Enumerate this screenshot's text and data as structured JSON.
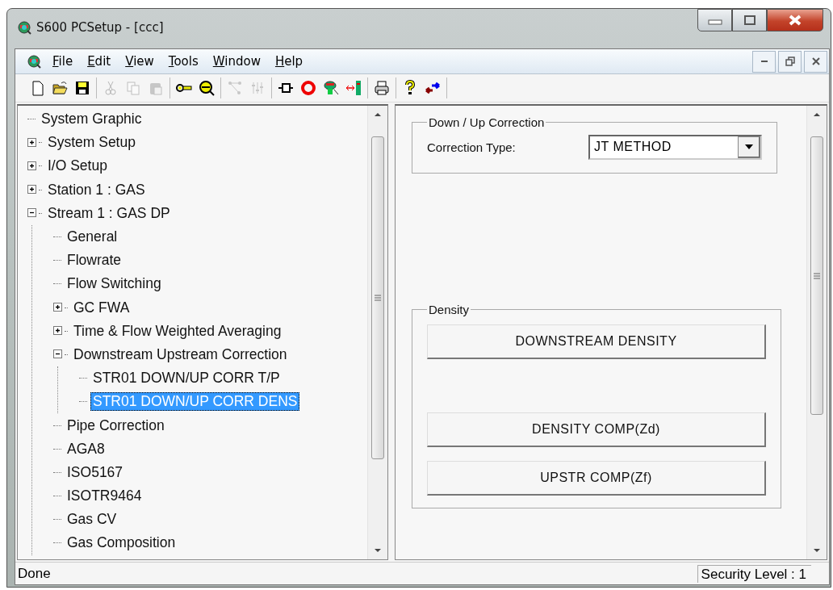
{
  "window": {
    "title": "S600 PCSetup - [ccc]"
  },
  "menu": [
    "File",
    "Edit",
    "View",
    "Tools",
    "Window",
    "Help"
  ],
  "toolbar": [
    [
      {
        "disabled": false
      },
      {
        "disabled": false
      },
      {
        "disabled": false
      }
    ],
    [
      {
        "disabled": true
      },
      {
        "disabled": true
      },
      {
        "disabled": true
      }
    ],
    [
      {
        "disabled": false
      },
      {
        "disabled": false
      }
    ],
    [
      {
        "disabled": true
      },
      {
        "disabled": true
      }
    ],
    [
      {
        "disabled": false
      },
      {
        "disabled": false
      },
      {
        "disabled": false
      },
      {
        "disabled": false
      }
    ],
    [
      {
        "disabled": false
      }
    ],
    [
      {
        "disabled": false
      },
      {
        "disabled": false
      }
    ]
  ],
  "tree": [
    {
      "label": "System Graphic",
      "selected": false
    },
    {
      "label": "System Setup",
      "expanded": false,
      "selected": false
    },
    {
      "label": "I/O Setup",
      "expanded": false,
      "selected": false
    },
    {
      "label": "Station 1 : GAS",
      "expanded": false,
      "selected": false
    },
    {
      "label": "Stream 1 : GAS DP",
      "expanded": true,
      "selected": false,
      "children": [
        {
          "label": "General",
          "selected": false
        },
        {
          "label": "Flowrate",
          "selected": false
        },
        {
          "label": "Flow Switching",
          "selected": false
        },
        {
          "label": "GC FWA",
          "expanded": false,
          "selected": false
        },
        {
          "label": "Time & Flow Weighted Averaging",
          "expanded": false,
          "selected": false
        },
        {
          "label": "Downstream Upstream Correction",
          "expanded": true,
          "selected": false,
          "children": [
            {
              "label": "STR01 DOWN/UP CORR T/P",
              "selected": false
            },
            {
              "label": "STR01 DOWN/UP CORR DENS",
              "selected": true
            }
          ]
        },
        {
          "label": "Pipe Correction",
          "selected": false
        },
        {
          "label": "AGA8",
          "selected": false
        },
        {
          "label": "ISO5167",
          "selected": false
        },
        {
          "label": "ISOTR9464",
          "selected": false
        },
        {
          "label": "Gas CV",
          "selected": false
        },
        {
          "label": "Gas Composition",
          "selected": false
        }
      ]
    }
  ],
  "panel": {
    "correction_group": {
      "title": "Down / Up Correction",
      "label": "Correction Type:",
      "value": "JT METHOD"
    },
    "density_group": {
      "title": "Density",
      "buttons": [
        "DOWNSTREAM DENSITY",
        "DENSITY COMP(Zd)",
        "UPSTR COMP(Zf)"
      ]
    }
  },
  "status_bar": {
    "message": "Done",
    "security": "Security Level : 1"
  }
}
